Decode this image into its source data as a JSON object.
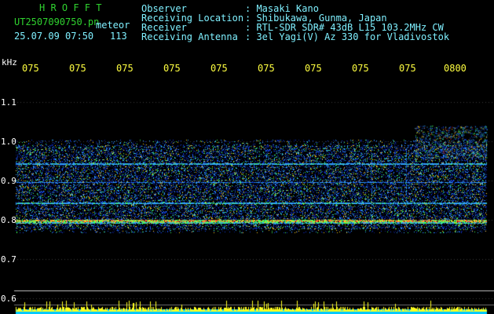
{
  "header": {
    "app_title": "H R O F F T",
    "file_name": "UT2507090750.pn",
    "mode_label": "meteor",
    "timestamp": "25.07.09 07:50",
    "count": "113",
    "fields": [
      {
        "label": "Observer",
        "value": ": Masaki Kano"
      },
      {
        "label": "Receiving Location",
        "value": ": Shibukawa, Gunma, Japan"
      },
      {
        "label": "Receiver",
        "value": ": RTL-SDR SDR# 43dB L15 103.2MHz CW"
      },
      {
        "label": "Receiving Antenna",
        "value": ": 3el Yagi(V) Az 330 for Vladivostok"
      }
    ]
  },
  "axis": {
    "unit": "kHz",
    "time_ticks": [
      "075",
      "075",
      "075",
      "075",
      "075",
      "075",
      "075",
      "075",
      "075",
      "0800"
    ],
    "freq_ticks": [
      "1.1",
      "1.0",
      "0.9",
      "0.8",
      "0.7",
      "0.6"
    ]
  },
  "colors": {
    "background": "#000000",
    "title": "#2fd22f",
    "header_text": "#7ff0ff",
    "time_ticks": "#ffff40",
    "gridline": "#c0c0c0"
  }
}
